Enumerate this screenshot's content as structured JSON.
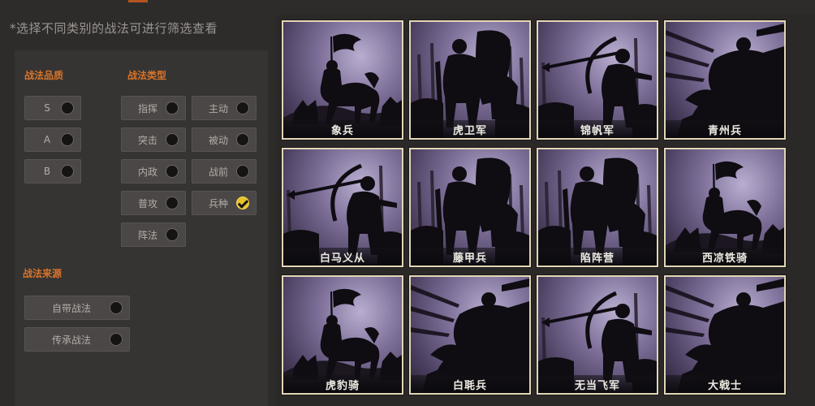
{
  "hint": "*选择不同类别的战法可进行筛选查看",
  "quality": {
    "title": "战法品质",
    "options": [
      {
        "label": "S",
        "checked": false
      },
      {
        "label": "A",
        "checked": false
      },
      {
        "label": "B",
        "checked": false
      }
    ]
  },
  "type": {
    "title": "战法类型",
    "options": [
      {
        "label": "指挥",
        "checked": false
      },
      {
        "label": "主动",
        "checked": false
      },
      {
        "label": "突击",
        "checked": false
      },
      {
        "label": "被动",
        "checked": false
      },
      {
        "label": "内政",
        "checked": false
      },
      {
        "label": "战前",
        "checked": false
      },
      {
        "label": "普攻",
        "checked": false
      },
      {
        "label": "兵种",
        "checked": true
      },
      {
        "label": "阵法",
        "checked": false
      }
    ]
  },
  "source": {
    "title": "战法来源",
    "options": [
      {
        "label": "自带战法",
        "checked": false
      },
      {
        "label": "传承战法",
        "checked": false
      }
    ]
  },
  "cards": [
    {
      "name": "象兵",
      "art": "flag-rider"
    },
    {
      "name": "虎卫军",
      "art": "shield-soldier"
    },
    {
      "name": "锦帆军",
      "art": "archer"
    },
    {
      "name": "青州兵",
      "art": "charge"
    },
    {
      "name": "白马义从",
      "art": "archer"
    },
    {
      "name": "藤甲兵",
      "art": "shield-soldier"
    },
    {
      "name": "陷阵营",
      "art": "shield-soldier"
    },
    {
      "name": "西凉铁骑",
      "art": "flag-rider"
    },
    {
      "name": "虎豹骑",
      "art": "flag-rider"
    },
    {
      "name": "白毦兵",
      "art": "charge"
    },
    {
      "name": "无当飞军",
      "art": "archer"
    },
    {
      "name": "大戟士",
      "art": "charge"
    }
  ]
}
